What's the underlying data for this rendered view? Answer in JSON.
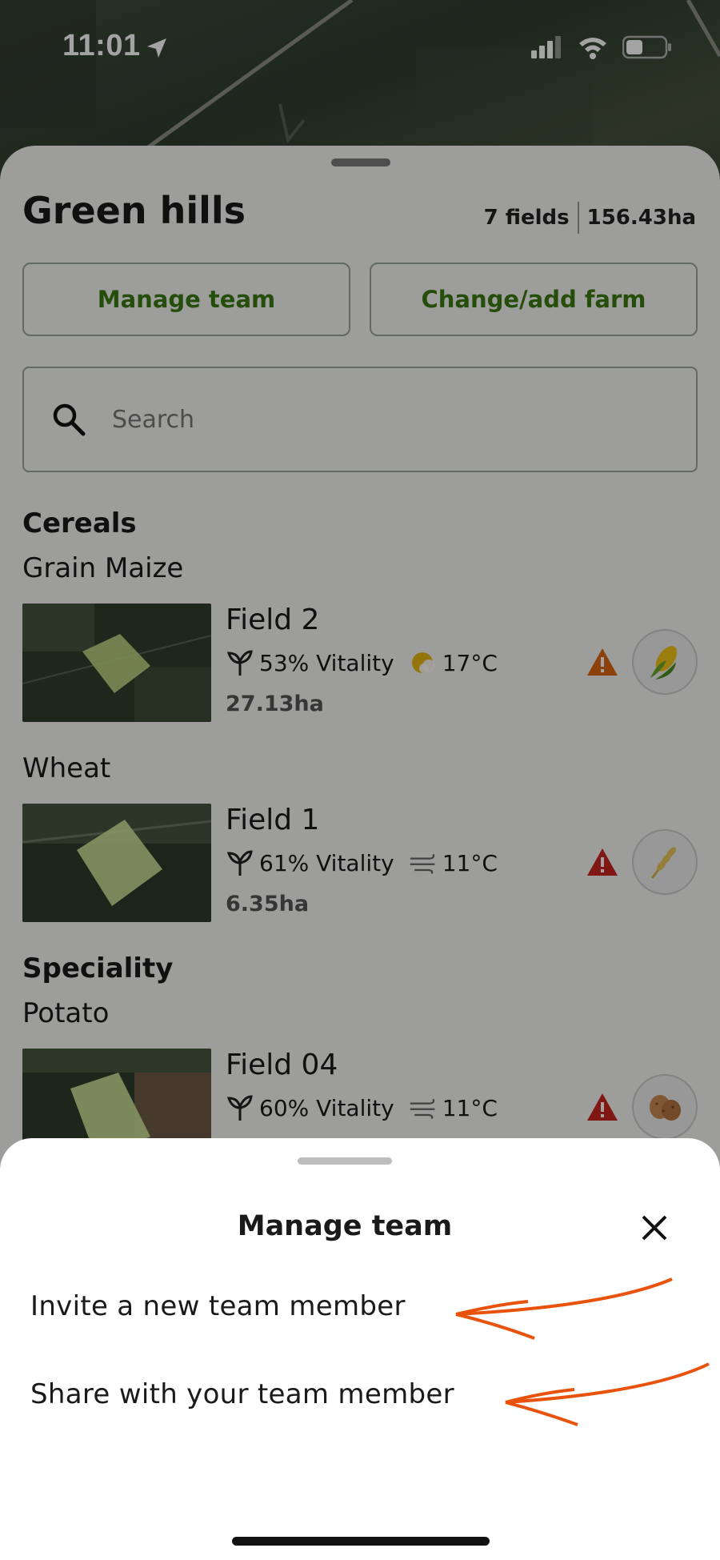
{
  "status_bar": {
    "time": "11:01"
  },
  "farm": {
    "name": "Green hills",
    "field_count": "7 fields",
    "area": "156.43ha",
    "buttons": {
      "manage_team": "Manage team",
      "change_farm": "Change/add farm"
    },
    "search_placeholder": "Search"
  },
  "categories": [
    {
      "title": "Cereals",
      "groups": [
        {
          "crop": "Grain Maize",
          "fields": [
            {
              "name": "Field 2",
              "vitality": "53% Vitality",
              "weather_icon": "partly-sunny-icon",
              "temp": "17°C",
              "area": "27.13ha",
              "warning_color": "#d9660f",
              "crop_icon": "corn-icon"
            }
          ]
        },
        {
          "crop": "Wheat",
          "fields": [
            {
              "name": "Field 1",
              "vitality": "61% Vitality",
              "weather_icon": "wind-icon",
              "temp": "11°C",
              "area": "6.35ha",
              "warning_color": "#c8241e",
              "crop_icon": "wheat-icon"
            }
          ]
        }
      ]
    },
    {
      "title": "Speciality",
      "groups": [
        {
          "crop": "Potato",
          "fields": [
            {
              "name": "Field 04",
              "vitality": "60% Vitality",
              "weather_icon": "wind-icon",
              "temp": "11°C",
              "warning_color": "#c8241e",
              "crop_icon": "potato-icon"
            }
          ]
        }
      ]
    }
  ],
  "modal": {
    "title": "Manage team",
    "items": [
      "Invite a new team member",
      "Share with your team member"
    ],
    "annotation_color": "#e8520a"
  },
  "colors": {
    "accent_green": "#3c7a12",
    "sheet_bg": "#f6f6f4"
  }
}
